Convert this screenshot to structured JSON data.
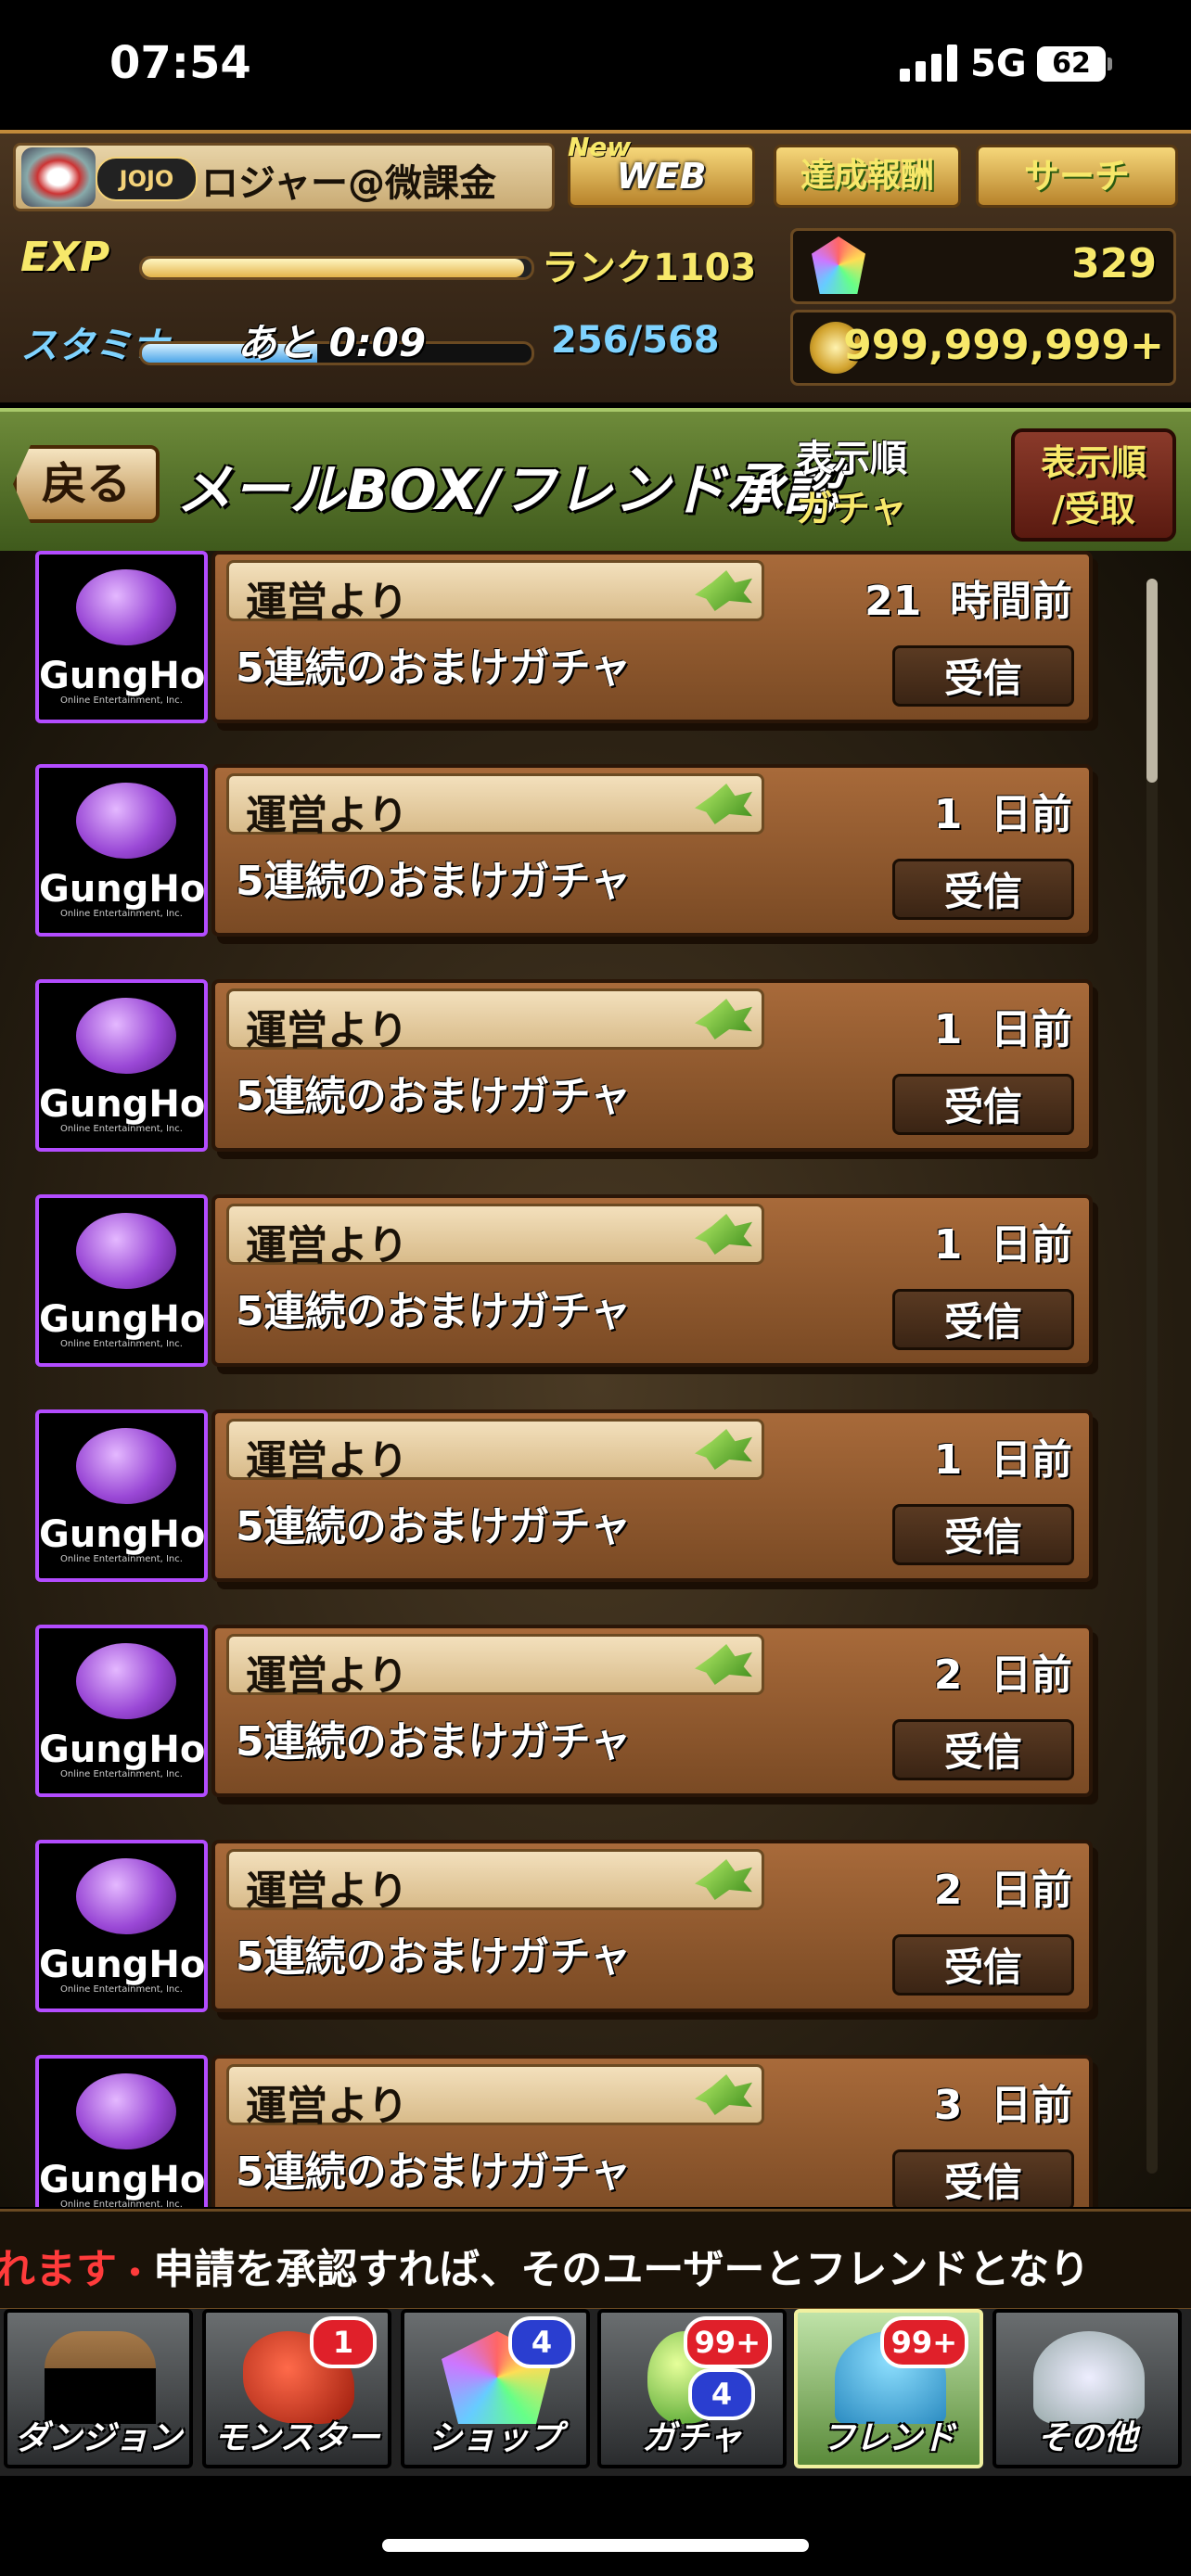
{
  "status_bar": {
    "time": "07:54",
    "network": "5G",
    "battery": "62"
  },
  "player": {
    "badge": "JOJO",
    "name": "ロジャー@微課金",
    "exp_label": "EXP",
    "exp_progress": 0.98,
    "rank_text": "ランク1103",
    "stamina_label": "スタミナ",
    "stamina_timer": "あと 0:09",
    "stamina_value": "256/568",
    "stamina_progress": 0.45,
    "magic_stones": "329",
    "coins": "999,999,999+"
  },
  "top_buttons": {
    "new_tag": "New",
    "web": "WEB",
    "achievements": "達成報酬",
    "search": "サーチ"
  },
  "header": {
    "back": "戻る",
    "title": "メールBOX/フレンド承認",
    "sort_label": "表示順",
    "sort_value": "ガチャ",
    "sort_button_line1": "表示順",
    "sort_button_line2": "/受取"
  },
  "mail_list": {
    "items": [
      {
        "logo": "GungHo",
        "logo_sub": "Online Entertainment, Inc.",
        "sender": "運営より",
        "time": "21  時間前",
        "subject": "5連続のおまけガチャ",
        "action": "受信"
      },
      {
        "logo": "GungHo",
        "logo_sub": "Online Entertainment, Inc.",
        "sender": "運営より",
        "time": "1  日前",
        "subject": "5連続のおまけガチャ",
        "action": "受信"
      },
      {
        "logo": "GungHo",
        "logo_sub": "Online Entertainment, Inc.",
        "sender": "運営より",
        "time": "1  日前",
        "subject": "5連続のおまけガチャ",
        "action": "受信"
      },
      {
        "logo": "GungHo",
        "logo_sub": "Online Entertainment, Inc.",
        "sender": "運営より",
        "time": "1  日前",
        "subject": "5連続のおまけガチャ",
        "action": "受信"
      },
      {
        "logo": "GungHo",
        "logo_sub": "Online Entertainment, Inc.",
        "sender": "運営より",
        "time": "1  日前",
        "subject": "5連続のおまけガチャ",
        "action": "受信"
      },
      {
        "logo": "GungHo",
        "logo_sub": "Online Entertainment, Inc.",
        "sender": "運営より",
        "time": "2  日前",
        "subject": "5連続のおまけガチャ",
        "action": "受信"
      },
      {
        "logo": "GungHo",
        "logo_sub": "Online Entertainment, Inc.",
        "sender": "運営より",
        "time": "2  日前",
        "subject": "5連続のおまけガチャ",
        "action": "受信"
      },
      {
        "logo": "GungHo",
        "logo_sub": "Online Entertainment, Inc.",
        "sender": "運営より",
        "time": "3  日前",
        "subject": "5連続のおまけガチャ",
        "action": "受信"
      }
    ]
  },
  "ticker": {
    "part1": "れます",
    "part2": "申請を承認すれば、そのユーザーとフレンドとなり"
  },
  "nav": {
    "items": [
      {
        "label": "ダンジョン",
        "icon": "dungeon-gate-icon"
      },
      {
        "label": "モンスター",
        "icon": "monster-icon",
        "badge": "1"
      },
      {
        "label": "ショップ",
        "icon": "magic-stone-icon",
        "badge": "4"
      },
      {
        "label": "ガチャ",
        "icon": "egg-icon",
        "badge": "99+",
        "badge2": "4"
      },
      {
        "label": "フレンド",
        "icon": "friends-icon",
        "badge": "99+"
      },
      {
        "label": "その他",
        "icon": "question-icon"
      }
    ]
  },
  "colors": {
    "accent_green": "#6e8b3a",
    "card_brown": "#a86a3a",
    "badge_red": "#e0202a",
    "badge_blue": "#2a3ed0",
    "logo_border": "#b34cff"
  }
}
